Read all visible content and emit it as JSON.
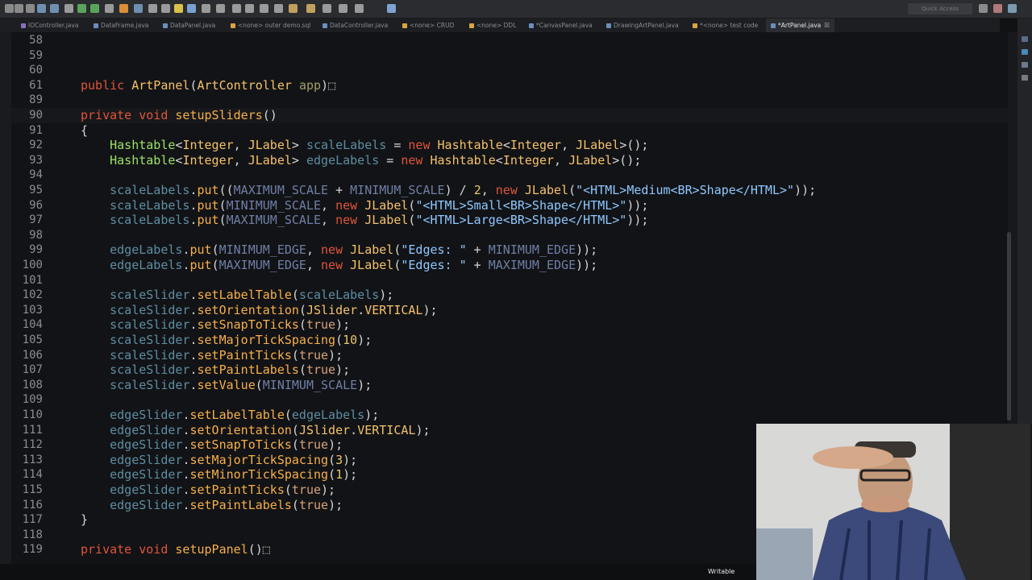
{
  "toolbar": {
    "quick_access_label": "Quick Access"
  },
  "tabs": [
    {
      "label": "IOController.java",
      "icon_color": "#8a6fbf",
      "active": false
    },
    {
      "label": "DataFrame.java",
      "icon_color": "#6a8fbf",
      "active": false
    },
    {
      "label": "DataPanel.java",
      "icon_color": "#6a8fbf",
      "active": false
    },
    {
      "label": "<none> outer demo.sql",
      "icon_color": "#d9a441",
      "active": false
    },
    {
      "label": "DataController.java",
      "icon_color": "#6a8fbf",
      "active": false
    },
    {
      "label": "<none> CRUD",
      "icon_color": "#d9a441",
      "active": false
    },
    {
      "label": "<none> DDL",
      "icon_color": "#d9a441",
      "active": false
    },
    {
      "label": "*CanvasPanel.java",
      "icon_color": "#6a8fbf",
      "active": false
    },
    {
      "label": "DrawingArtPanel.java",
      "icon_color": "#6a8fbf",
      "active": false
    },
    {
      "label": "*<none> test code",
      "icon_color": "#d9a441",
      "active": false
    },
    {
      "label": "*ArtPanel.java",
      "icon_color": "#6a8fbf",
      "active": true
    }
  ],
  "active_tab_close": "☒",
  "editor": {
    "lines": [
      {
        "n": "58",
        "segs": []
      },
      {
        "n": "59",
        "segs": []
      },
      {
        "n": "60",
        "segs": []
      },
      {
        "n": "61",
        "segs": [
          [
            "kw",
            "public "
          ],
          [
            "ty",
            "ArtPanel"
          ],
          [
            "pl",
            "("
          ],
          [
            "ty",
            "ArtController"
          ],
          [
            "pl",
            " "
          ],
          [
            "par",
            "app"
          ],
          [
            "pl",
            ")"
          ],
          [
            "pl",
            "⬚"
          ]
        ]
      },
      {
        "n": "89",
        "segs": []
      },
      {
        "n": "90",
        "hl": true,
        "segs": [
          [
            "kw",
            "private void "
          ],
          [
            "fn",
            "setupSliders"
          ],
          [
            "pl",
            "()"
          ]
        ]
      },
      {
        "n": "91",
        "segs": [
          [
            "pl",
            "{"
          ]
        ]
      },
      {
        "n": "92",
        "segs": [
          [
            "pl",
            "    "
          ],
          [
            "grn",
            "Hashtable"
          ],
          [
            "pl",
            "<"
          ],
          [
            "ty",
            "Integer"
          ],
          [
            "pl",
            ", "
          ],
          [
            "ty",
            "JLabel"
          ],
          [
            "pl",
            "> "
          ],
          [
            "fld",
            "scaleLabels"
          ],
          [
            "pl",
            " = "
          ],
          [
            "kw",
            "new "
          ],
          [
            "ty",
            "Hashtable"
          ],
          [
            "pl",
            "<"
          ],
          [
            "ty",
            "Integer"
          ],
          [
            "pl",
            ", "
          ],
          [
            "ty",
            "JLabel"
          ],
          [
            "pl",
            ">();"
          ]
        ]
      },
      {
        "n": "93",
        "segs": [
          [
            "pl",
            "    "
          ],
          [
            "grn",
            "Hashtable"
          ],
          [
            "pl",
            "<"
          ],
          [
            "ty",
            "Integer"
          ],
          [
            "pl",
            ", "
          ],
          [
            "ty",
            "JLabel"
          ],
          [
            "pl",
            "> "
          ],
          [
            "fld",
            "edgeLabels"
          ],
          [
            "pl",
            " = "
          ],
          [
            "kw",
            "new "
          ],
          [
            "ty",
            "Hashtable"
          ],
          [
            "pl",
            "<"
          ],
          [
            "ty",
            "Integer"
          ],
          [
            "pl",
            ", "
          ],
          [
            "ty",
            "JLabel"
          ],
          [
            "pl",
            ">();"
          ]
        ]
      },
      {
        "n": "94",
        "segs": []
      },
      {
        "n": "95",
        "segs": [
          [
            "pl",
            "    "
          ],
          [
            "fld",
            "scaleLabels"
          ],
          [
            "pl",
            "."
          ],
          [
            "fn",
            "put"
          ],
          [
            "pl",
            "(("
          ],
          [
            "cst",
            "MAXIMUM_SCALE"
          ],
          [
            "pl",
            " + "
          ],
          [
            "cst",
            "MINIMUM_SCALE"
          ],
          [
            "pl",
            ") / "
          ],
          [
            "num",
            "2"
          ],
          [
            "pl",
            ", "
          ],
          [
            "kw",
            "new "
          ],
          [
            "ty",
            "JLabel"
          ],
          [
            "pl",
            "("
          ],
          [
            "str",
            "\"<HTML>Medium<BR>Shape</HTML>\""
          ],
          [
            "pl",
            "));"
          ]
        ]
      },
      {
        "n": "96",
        "segs": [
          [
            "pl",
            "    "
          ],
          [
            "fld",
            "scaleLabels"
          ],
          [
            "pl",
            "."
          ],
          [
            "fn",
            "put"
          ],
          [
            "pl",
            "("
          ],
          [
            "cst",
            "MINIMUM_SCALE"
          ],
          [
            "pl",
            ", "
          ],
          [
            "kw",
            "new "
          ],
          [
            "ty",
            "JLabel"
          ],
          [
            "pl",
            "("
          ],
          [
            "str",
            "\"<HTML>Small<BR>Shape</HTML>\""
          ],
          [
            "pl",
            "));"
          ]
        ]
      },
      {
        "n": "97",
        "segs": [
          [
            "pl",
            "    "
          ],
          [
            "fld",
            "scaleLabels"
          ],
          [
            "pl",
            "."
          ],
          [
            "fn",
            "put"
          ],
          [
            "pl",
            "("
          ],
          [
            "cst",
            "MAXIMUM_SCALE"
          ],
          [
            "pl",
            ", "
          ],
          [
            "kw",
            "new "
          ],
          [
            "ty",
            "JLabel"
          ],
          [
            "pl",
            "("
          ],
          [
            "str",
            "\"<HTML>Large<BR>Shape</HTML>\""
          ],
          [
            "pl",
            "));"
          ]
        ]
      },
      {
        "n": "98",
        "segs": []
      },
      {
        "n": "99",
        "segs": [
          [
            "pl",
            "    "
          ],
          [
            "fld",
            "edgeLabels"
          ],
          [
            "pl",
            "."
          ],
          [
            "fn",
            "put"
          ],
          [
            "pl",
            "("
          ],
          [
            "cst",
            "MINIMUM_EDGE"
          ],
          [
            "pl",
            ", "
          ],
          [
            "kw",
            "new "
          ],
          [
            "ty",
            "JLabel"
          ],
          [
            "pl",
            "("
          ],
          [
            "str",
            "\"Edges: \""
          ],
          [
            "pl",
            " + "
          ],
          [
            "cst",
            "MINIMUM_EDGE"
          ],
          [
            "pl",
            "));"
          ]
        ]
      },
      {
        "n": "100",
        "segs": [
          [
            "pl",
            "    "
          ],
          [
            "fld",
            "edgeLabels"
          ],
          [
            "pl",
            "."
          ],
          [
            "fn",
            "put"
          ],
          [
            "pl",
            "("
          ],
          [
            "cst",
            "MAXIMUM_EDGE"
          ],
          [
            "pl",
            ", "
          ],
          [
            "kw",
            "new "
          ],
          [
            "ty",
            "JLabel"
          ],
          [
            "pl",
            "("
          ],
          [
            "str",
            "\"Edges: \""
          ],
          [
            "pl",
            " + "
          ],
          [
            "cst",
            "MAXIMUM_EDGE"
          ],
          [
            "pl",
            "));"
          ]
        ]
      },
      {
        "n": "101",
        "segs": []
      },
      {
        "n": "102",
        "segs": [
          [
            "pl",
            "    "
          ],
          [
            "fld",
            "scaleSlider"
          ],
          [
            "pl",
            "."
          ],
          [
            "fn",
            "setLabelTable"
          ],
          [
            "pl",
            "("
          ],
          [
            "fld",
            "scaleLabels"
          ],
          [
            "pl",
            ");"
          ]
        ]
      },
      {
        "n": "103",
        "segs": [
          [
            "pl",
            "    "
          ],
          [
            "fld",
            "scaleSlider"
          ],
          [
            "pl",
            "."
          ],
          [
            "fn",
            "setOrientation"
          ],
          [
            "pl",
            "("
          ],
          [
            "ty",
            "JSlider"
          ],
          [
            "pl",
            "."
          ],
          [
            "ty",
            "VERTICAL"
          ],
          [
            "pl",
            ");"
          ]
        ]
      },
      {
        "n": "104",
        "segs": [
          [
            "pl",
            "    "
          ],
          [
            "fld",
            "scaleSlider"
          ],
          [
            "pl",
            "."
          ],
          [
            "fn",
            "setSnapToTicks"
          ],
          [
            "pl",
            "("
          ],
          [
            "lit",
            "true"
          ],
          [
            "pl",
            ");"
          ]
        ]
      },
      {
        "n": "105",
        "segs": [
          [
            "pl",
            "    "
          ],
          [
            "fld",
            "scaleSlider"
          ],
          [
            "pl",
            "."
          ],
          [
            "fn",
            "setMajorTickSpacing"
          ],
          [
            "pl",
            "("
          ],
          [
            "num",
            "10"
          ],
          [
            "pl",
            ");"
          ]
        ]
      },
      {
        "n": "106",
        "segs": [
          [
            "pl",
            "    "
          ],
          [
            "fld",
            "scaleSlider"
          ],
          [
            "pl",
            "."
          ],
          [
            "fn",
            "setPaintTicks"
          ],
          [
            "pl",
            "("
          ],
          [
            "lit",
            "true"
          ],
          [
            "pl",
            ");"
          ]
        ]
      },
      {
        "n": "107",
        "segs": [
          [
            "pl",
            "    "
          ],
          [
            "fld",
            "scaleSlider"
          ],
          [
            "pl",
            "."
          ],
          [
            "fn",
            "setPaintLabels"
          ],
          [
            "pl",
            "("
          ],
          [
            "lit",
            "true"
          ],
          [
            "pl",
            ");"
          ]
        ]
      },
      {
        "n": "108",
        "segs": [
          [
            "pl",
            "    "
          ],
          [
            "fld",
            "scaleSlider"
          ],
          [
            "pl",
            "."
          ],
          [
            "fn",
            "setValue"
          ],
          [
            "pl",
            "("
          ],
          [
            "cst",
            "MINIMUM_SCALE"
          ],
          [
            "pl",
            ");"
          ]
        ]
      },
      {
        "n": "109",
        "segs": []
      },
      {
        "n": "110",
        "segs": [
          [
            "pl",
            "    "
          ],
          [
            "fld",
            "edgeSlider"
          ],
          [
            "pl",
            "."
          ],
          [
            "fn",
            "setLabelTable"
          ],
          [
            "pl",
            "("
          ],
          [
            "fld",
            "edgeLabels"
          ],
          [
            "pl",
            ");"
          ]
        ]
      },
      {
        "n": "111",
        "segs": [
          [
            "pl",
            "    "
          ],
          [
            "fld",
            "edgeSlider"
          ],
          [
            "pl",
            "."
          ],
          [
            "fn",
            "setOrientation"
          ],
          [
            "pl",
            "("
          ],
          [
            "ty",
            "JSlider"
          ],
          [
            "pl",
            "."
          ],
          [
            "ty",
            "VERTICAL"
          ],
          [
            "pl",
            ");"
          ]
        ]
      },
      {
        "n": "112",
        "segs": [
          [
            "pl",
            "    "
          ],
          [
            "fld",
            "edgeSlider"
          ],
          [
            "pl",
            "."
          ],
          [
            "fn",
            "setSnapToTicks"
          ],
          [
            "pl",
            "("
          ],
          [
            "lit",
            "true"
          ],
          [
            "pl",
            ");"
          ]
        ]
      },
      {
        "n": "113",
        "segs": [
          [
            "pl",
            "    "
          ],
          [
            "fld",
            "edgeSlider"
          ],
          [
            "pl",
            "."
          ],
          [
            "fn",
            "setMajorTickSpacing"
          ],
          [
            "pl",
            "("
          ],
          [
            "num",
            "3"
          ],
          [
            "pl",
            ");"
          ]
        ]
      },
      {
        "n": "114",
        "segs": [
          [
            "pl",
            "    "
          ],
          [
            "fld",
            "edgeSlider"
          ],
          [
            "pl",
            "."
          ],
          [
            "fn",
            "setMinorTickSpacing"
          ],
          [
            "pl",
            "("
          ],
          [
            "num",
            "1"
          ],
          [
            "pl",
            ");"
          ]
        ]
      },
      {
        "n": "115",
        "segs": [
          [
            "pl",
            "    "
          ],
          [
            "fld",
            "edgeSlider"
          ],
          [
            "pl",
            "."
          ],
          [
            "fn",
            "setPaintTicks"
          ],
          [
            "pl",
            "("
          ],
          [
            "lit",
            "true"
          ],
          [
            "pl",
            ");"
          ]
        ]
      },
      {
        "n": "116",
        "segs": [
          [
            "pl",
            "    "
          ],
          [
            "fld",
            "edgeSlider"
          ],
          [
            "pl",
            "."
          ],
          [
            "fn",
            "setPaintLabels"
          ],
          [
            "pl",
            "("
          ],
          [
            "lit",
            "true"
          ],
          [
            "pl",
            ");"
          ]
        ]
      },
      {
        "n": "117",
        "segs": [
          [
            "pl",
            "}"
          ]
        ]
      },
      {
        "n": "118",
        "segs": []
      },
      {
        "n": "119",
        "segs": [
          [
            "kw",
            "private void "
          ],
          [
            "fn",
            "setupPanel"
          ],
          [
            "pl",
            "()"
          ],
          [
            "pl",
            "⬚"
          ]
        ]
      }
    ]
  },
  "status": {
    "writable": "Writable"
  },
  "colors": {
    "keyword": "#e0553b",
    "type": "#f5c26b",
    "method": "#f7b04a",
    "field": "#5d8ea3",
    "string": "#8ec8ff",
    "background": "#121316"
  }
}
